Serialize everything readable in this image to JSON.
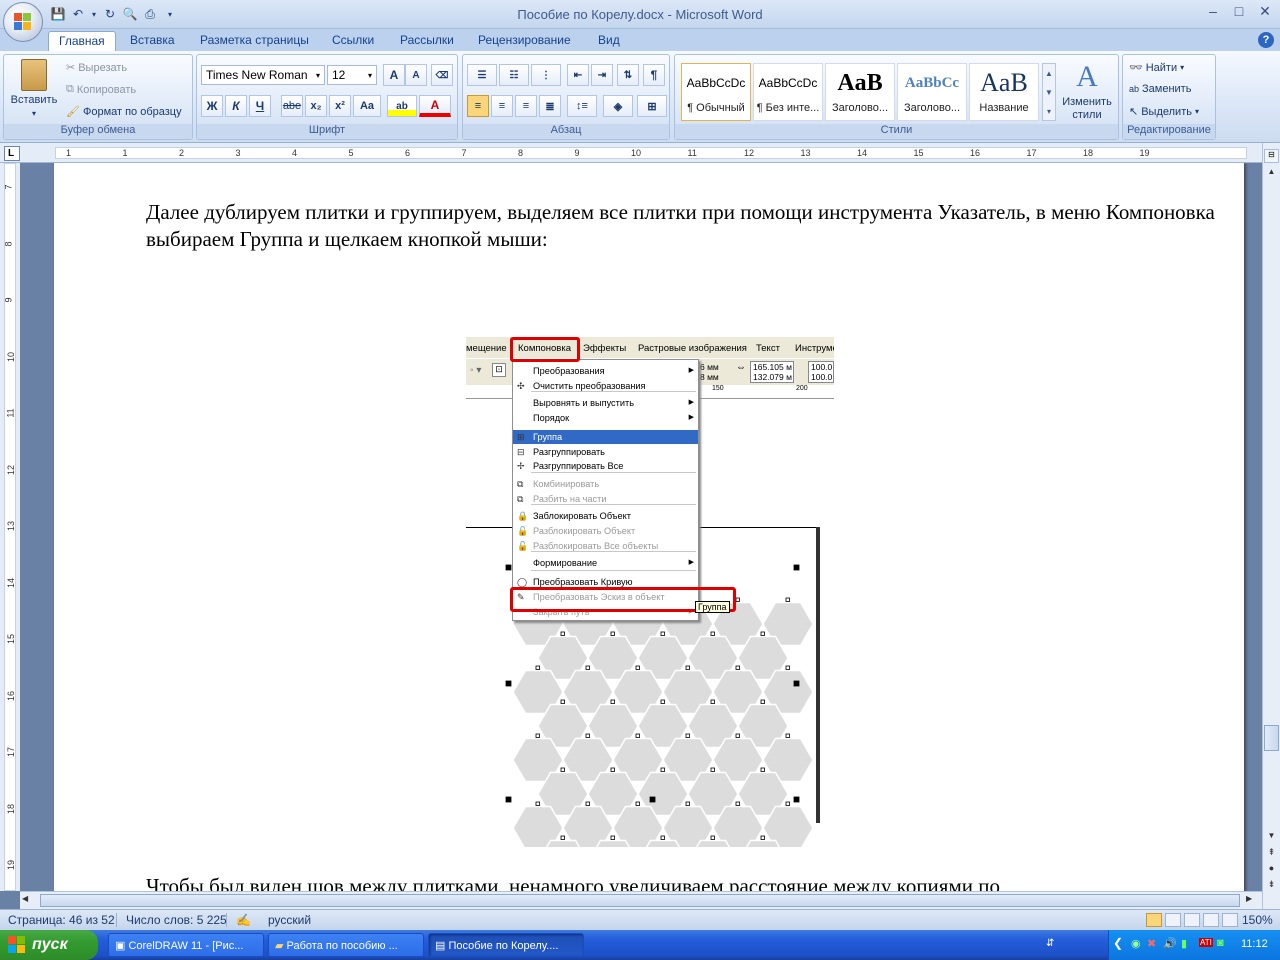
{
  "window": {
    "title": "Пособие по Корелу.docx - Microsoft Word",
    "qat_icons": [
      "save-icon",
      "undo-icon",
      "redo-icon",
      "print-preview-icon",
      "quick-print-icon",
      "customize-icon"
    ]
  },
  "tabs": [
    "Главная",
    "Вставка",
    "Разметка страницы",
    "Ссылки",
    "Рассылки",
    "Рецензирование",
    "Вид"
  ],
  "ribbon": {
    "clipboard": {
      "label": "Буфер обмена",
      "paste": "Вставить",
      "cut": "Вырезать",
      "copy": "Копировать",
      "format_painter": "Формат по образцу"
    },
    "font": {
      "label": "Шрифт",
      "font_name": "Times New Roman",
      "font_size": "12",
      "bold": "Ж",
      "italic": "К",
      "underline": "Ч",
      "strike": "abe",
      "subscript": "x₂",
      "superscript": "x²",
      "change_case": "Aa",
      "font_color": "A",
      "grow": "A",
      "shrink": "A"
    },
    "paragraph": {
      "label": "Абзац"
    },
    "styles": {
      "label": "Стили",
      "items": [
        {
          "preview": "AaBbCcDc",
          "name": "¶ Обычный"
        },
        {
          "preview": "AaBbCcDc",
          "name": "¶ Без инте..."
        },
        {
          "preview": "AaB",
          "name": "Заголово..."
        },
        {
          "preview": "AaBbCc",
          "name": "Заголово..."
        },
        {
          "preview": "AaB",
          "name": "Название"
        }
      ],
      "change_styles": "Изменить стили"
    },
    "editing": {
      "label": "Редактирование",
      "find": "Найти",
      "replace": "Заменить",
      "select": "Выделить"
    }
  },
  "ruler": {
    "h_numbers": [
      "1",
      "1",
      "2",
      "3",
      "4",
      "5",
      "6",
      "7",
      "8",
      "9",
      "10",
      "11",
      "12",
      "13",
      "14",
      "15",
      "16",
      "17",
      "18",
      "19"
    ],
    "v_numbers": [
      "7",
      "8",
      "9",
      "10",
      "11",
      "12",
      "13",
      "14",
      "15",
      "16",
      "17",
      "18",
      "19"
    ]
  },
  "document": {
    "para1": "Далее дублируем плитки и группируем, выделяем все плитки при помощи инструмента Указатель, в меню Компоновка выбираем Группа и щелкаем кнопкой мыши:",
    "para2": "Чтобы был виден шов между плитками, ненамного увеличиваем расстояние между копиями по"
  },
  "embedded": {
    "menubar": [
      "мещение",
      "Компоновка",
      "Эффекты",
      "Растровые изображения",
      "Текст",
      "Инструме"
    ],
    "tool_values": [
      "6 мм",
      "8 мм",
      "165.105 м",
      "132.079 м",
      "100.0",
      "100.0"
    ],
    "ruler_mark": "150",
    "ruler_mark2": "200",
    "menu": [
      {
        "label": "Преобразования",
        "submenu": true,
        "enabled": true
      },
      {
        "label": "Очистить преобразования",
        "submenu": false,
        "enabled": true
      },
      {
        "label": "Выровнять и выпустить",
        "submenu": true,
        "enabled": true
      },
      {
        "label": "Порядок",
        "submenu": true,
        "enabled": true
      },
      {
        "label": "Группа",
        "submenu": false,
        "enabled": true
      },
      {
        "label": "Разгруппировать",
        "submenu": false,
        "enabled": true
      },
      {
        "label": "Разгруппировать Все",
        "submenu": false,
        "enabled": true
      },
      {
        "label": "Комбинировать",
        "submenu": false,
        "enabled": false
      },
      {
        "label": "Разбить на части",
        "submenu": false,
        "enabled": false
      },
      {
        "label": "Заблокировать Объект",
        "submenu": false,
        "enabled": true
      },
      {
        "label": "Разблокировать Объект",
        "submenu": false,
        "enabled": false
      },
      {
        "label": "Разблокировать Все объекты",
        "submenu": false,
        "enabled": false
      },
      {
        "label": "Формирование",
        "submenu": true,
        "enabled": true
      },
      {
        "label": "Преобразовать Кривую",
        "submenu": false,
        "enabled": true
      },
      {
        "label": "Преобразовать Эскиз в объект",
        "submenu": false,
        "enabled": false
      },
      {
        "label": "Закрыть путь",
        "submenu": true,
        "enabled": false
      }
    ],
    "tooltip": "Группа"
  },
  "status": {
    "page": "Страница: 46 из 52",
    "words": "Число слов: 5 225",
    "language": "русский",
    "zoom": "150%"
  },
  "taskbar": {
    "start": "пуск",
    "tasks": [
      "CorelDRAW 11 - [Рис...",
      "Работа по пособию ...",
      "Пособие по Корелу...."
    ],
    "clock": "11:12"
  },
  "colors": {
    "accent": "#15428b",
    "highlight": "#316ac5",
    "red_frame": "#e00000"
  }
}
